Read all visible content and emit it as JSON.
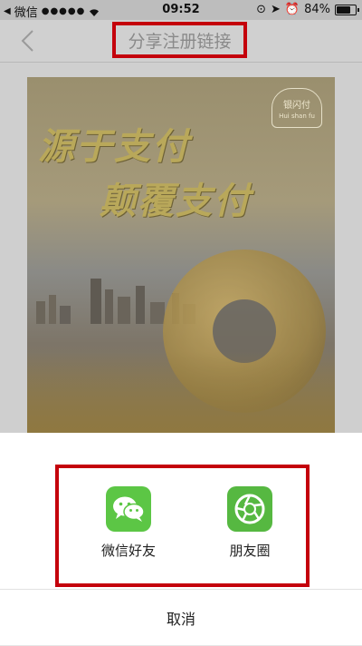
{
  "status_bar": {
    "back_app": "微信",
    "signal": "●●●●●",
    "time": "09:52",
    "battery": "84%",
    "battery_level": 0.84
  },
  "nav": {
    "title": "分享注册链接",
    "back_icon": "chevron-left-icon"
  },
  "poster": {
    "logo_text": "银闪付",
    "logo_sub": "Hui shan fu",
    "headline_1": "源于支付",
    "headline_2": "颠覆支付"
  },
  "share": {
    "options": [
      {
        "label": "微信好友",
        "icon": "wechat-icon",
        "color": "#5cc645"
      },
      {
        "label": "朋友圈",
        "icon": "moments-icon",
        "color": "#56b841"
      }
    ],
    "cancel_label": "取消"
  },
  "colors": {
    "highlight_box": "#c4000b",
    "overlay": "#cfcfcf"
  }
}
